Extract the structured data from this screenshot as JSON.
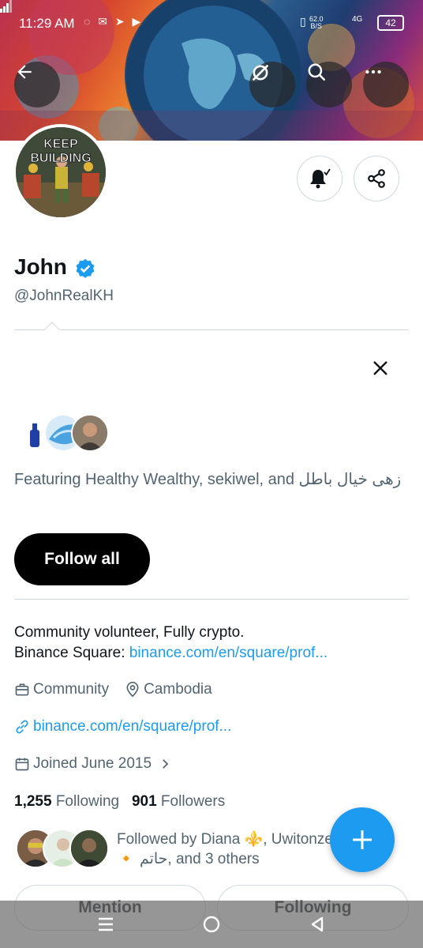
{
  "status_bar": {
    "time": "11:29 AM",
    "net_speed_value": "62.0",
    "net_speed_unit": "B/S",
    "network": "4G",
    "battery": "42"
  },
  "header": {
    "back_icon": "arrow-left-icon",
    "grok_icon": "grok-icon",
    "search_icon": "search-icon",
    "more_icon": "more-horizontal-icon"
  },
  "profile": {
    "avatar_text_line1": "KEEP",
    "avatar_text_line2": "BUILDING",
    "name": "John",
    "handle": "@JohnRealKH",
    "verified_color": "#1d9bf0"
  },
  "actions": {
    "notify_icon": "bell-check-icon",
    "share_icon": "share-icon"
  },
  "suggestions": {
    "featuring_text": "Featuring Healthy Wealthy, sekiwel, and زهی خیال باطل",
    "follow_all_label": "Follow all"
  },
  "bio": {
    "line1": "Community volunteer, Fully crypto.",
    "line2_prefix": "Binance Square: ",
    "line2_link": "binance.com/en/square/prof..."
  },
  "meta": {
    "category": "Community",
    "location": "Cambodia",
    "website": "binance.com/en/square/prof...",
    "joined": "Joined June 2015"
  },
  "counts": {
    "following_count": "1,255",
    "following_label": "Following",
    "followers_count": "901",
    "followers_label": "Followers"
  },
  "followed_by": {
    "line1": "Followed by Diana ⚜️, Uwitonze",
    "line2": "🔸 حاتم, and 3 others"
  },
  "bottom_actions": {
    "mention_label": "Mention",
    "following_label": "Following"
  },
  "colors": {
    "accent": "#1d9bf0",
    "text_primary": "#0f1419",
    "text_secondary": "#536471"
  }
}
